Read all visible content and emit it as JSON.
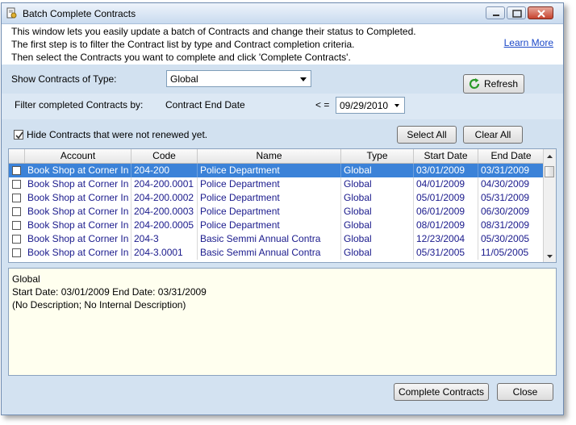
{
  "window": {
    "title": "Batch Complete Contracts"
  },
  "intro": {
    "lines": [
      "This window lets you easily update a batch of Contracts and change their status to Completed.",
      "The first step is to filter the Contract list by type and Contract completion criteria.",
      "Then select the Contracts you want to complete and click 'Complete Contracts'."
    ],
    "learn_more": "Learn More"
  },
  "filters": {
    "type_label": "Show Contracts of Type:",
    "type_value": "Global",
    "refresh_label": "Refresh",
    "completed_label": "Filter completed Contracts by:",
    "criteria_label": "Contract End Date",
    "operator": "< =",
    "date_value": "09/29/2010",
    "hide_label": "Hide Contracts that were not renewed yet.",
    "hide_checked": true,
    "select_all": "Select All",
    "clear_all": "Clear All"
  },
  "grid": {
    "columns": [
      "Account",
      "Code",
      "Name",
      "Type",
      "Start Date",
      "End Date"
    ],
    "rows": [
      {
        "account": "Book Shop at Corner In",
        "code": "204-200",
        "name": "Police Department",
        "type": "Global",
        "start": "03/01/2009",
        "end": "03/31/2009",
        "selected": true
      },
      {
        "account": "Book Shop at Corner In",
        "code": "204-200.0001",
        "name": "Police Department",
        "type": "Global",
        "start": "04/01/2009",
        "end": "04/30/2009",
        "selected": false
      },
      {
        "account": "Book Shop at Corner In",
        "code": "204-200.0002",
        "name": "Police Department",
        "type": "Global",
        "start": "05/01/2009",
        "end": "05/31/2009",
        "selected": false
      },
      {
        "account": "Book Shop at Corner In",
        "code": "204-200.0003",
        "name": "Police Department",
        "type": "Global",
        "start": "06/01/2009",
        "end": "06/30/2009",
        "selected": false
      },
      {
        "account": "Book Shop at Corner In",
        "code": "204-200.0005",
        "name": "Police Department",
        "type": "Global",
        "start": "08/01/2009",
        "end": "08/31/2009",
        "selected": false
      },
      {
        "account": "Book Shop at Corner In",
        "code": "204-3",
        "name": "Basic Semmi Annual Contra",
        "type": "Global",
        "start": "12/23/2004",
        "end": "05/30/2005",
        "selected": false
      },
      {
        "account": "Book Shop at Corner In",
        "code": "204-3.0001",
        "name": "Basic Semmi Annual Contra",
        "type": "Global",
        "start": "05/31/2005",
        "end": "11/05/2005",
        "selected": false
      }
    ]
  },
  "description": {
    "lines": [
      "Global",
      "Start Date: 03/01/2009 End Date: 03/31/2009",
      "(No Description; No Internal Description)"
    ]
  },
  "footer": {
    "complete_label": "Complete Contracts",
    "close_label": "Close"
  },
  "colors": {
    "selected_row": "#3b82d8",
    "cell_text": "#1a1a8c",
    "link": "#1a47c8"
  }
}
